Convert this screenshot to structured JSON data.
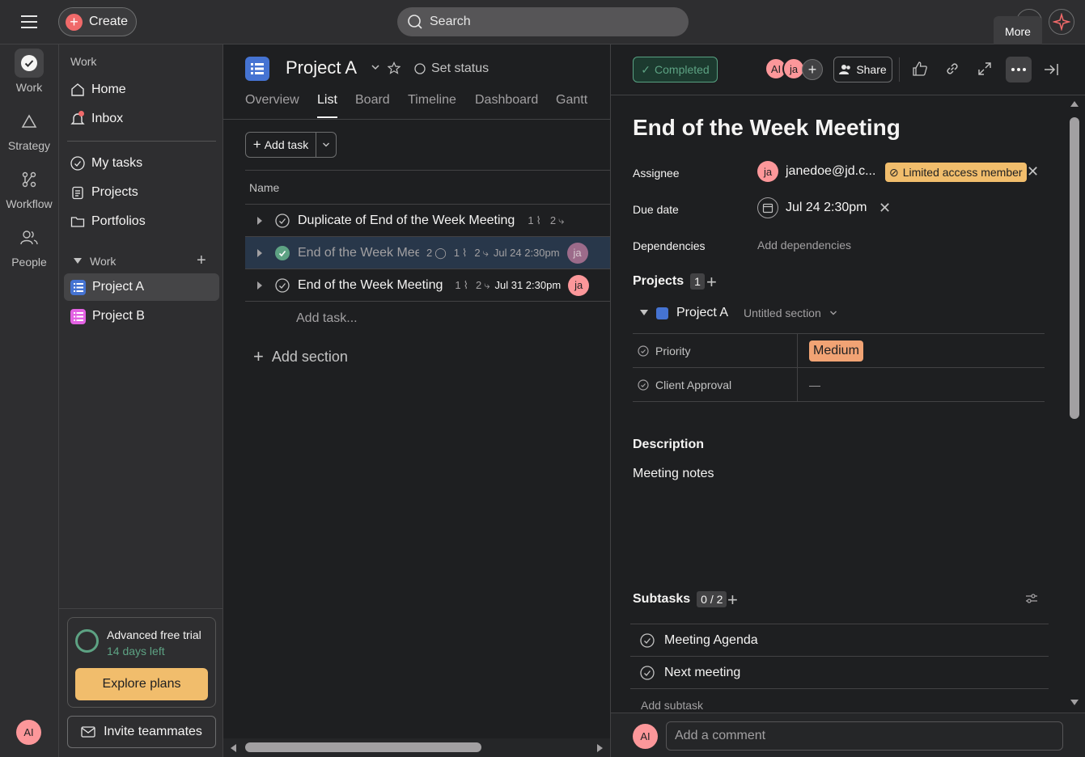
{
  "topbar": {
    "create_label": "Create",
    "search_placeholder": "Search",
    "tooltip": "More"
  },
  "rail": {
    "items": [
      {
        "label": "Work"
      },
      {
        "label": "Strategy"
      },
      {
        "label": "Workflow"
      },
      {
        "label": "People"
      }
    ],
    "user_initials": "AI"
  },
  "sidebar": {
    "section_title": "Work",
    "nav": [
      {
        "label": "Home"
      },
      {
        "label": "Inbox"
      }
    ],
    "nav2": [
      {
        "label": "My tasks"
      },
      {
        "label": "Projects"
      },
      {
        "label": "Portfolios"
      }
    ],
    "group_title": "Work",
    "projects": [
      {
        "label": "Project A",
        "color": "#4573d2"
      },
      {
        "label": "Project B",
        "color": "#e362e3"
      }
    ],
    "trial": {
      "title": "Advanced free trial",
      "days": "14 days left",
      "cta": "Explore plans"
    },
    "invite_label": "Invite teammates"
  },
  "main": {
    "project_title": "Project A",
    "set_status": "Set status",
    "tabs": [
      "Overview",
      "List",
      "Board",
      "Timeline",
      "Dashboard",
      "Gantt"
    ],
    "active_tab": "List",
    "add_task_label": "Add task",
    "column_name": "Name",
    "tasks": [
      {
        "name": "Duplicate of End of the Week Meeting",
        "comments": "",
        "attachments": "1",
        "subtasks": "2",
        "due": "",
        "assignee": ""
      },
      {
        "name": "End of the Week Mee",
        "comments": "2",
        "attachments": "1",
        "subtasks": "2",
        "due": "Jul 24 2:30pm",
        "assignee": "ja"
      },
      {
        "name": "End of the Week Meeting",
        "comments": "",
        "attachments": "1",
        "subtasks": "2",
        "due": "Jul 31 2:30pm",
        "assignee": "ja"
      }
    ],
    "add_task_placeholder": "Add task...",
    "add_section_label": "Add section"
  },
  "detail": {
    "completed_label": "Completed",
    "collaborators": [
      "AI",
      "ja"
    ],
    "share_label": "Share",
    "title": "End of the Week Meeting",
    "assignee_label": "Assignee",
    "assignee_initials": "ja",
    "assignee_email": "janedoe@jd.c...",
    "limited_access": "Limited access member",
    "due_label": "Due date",
    "due_value": "Jul 24 2:30pm",
    "dependencies_label": "Dependencies",
    "add_dependencies": "Add dependencies",
    "projects_label": "Projects",
    "projects_count": "1",
    "project_name": "Project A",
    "section_name": "Untitled section",
    "fields": [
      {
        "label": "Priority",
        "value": "Medium"
      },
      {
        "label": "Client Approval",
        "value": "—"
      }
    ],
    "priority_color": "#f1a374",
    "description_label": "Description",
    "description_text": "Meeting notes",
    "subtasks_label": "Subtasks",
    "subtasks_count": "0 / 2",
    "subtasks": [
      {
        "name": "Meeting Agenda"
      },
      {
        "name": "Next meeting"
      }
    ],
    "add_subtask": "Add subtask",
    "comment_initials": "AI",
    "comment_placeholder": "Add a comment"
  },
  "colors": {
    "accent_red": "#f06a6a",
    "completed_green": "#5da283",
    "avatar_pink": "#fc979a",
    "avatar_purple": "#9c6b8a"
  }
}
